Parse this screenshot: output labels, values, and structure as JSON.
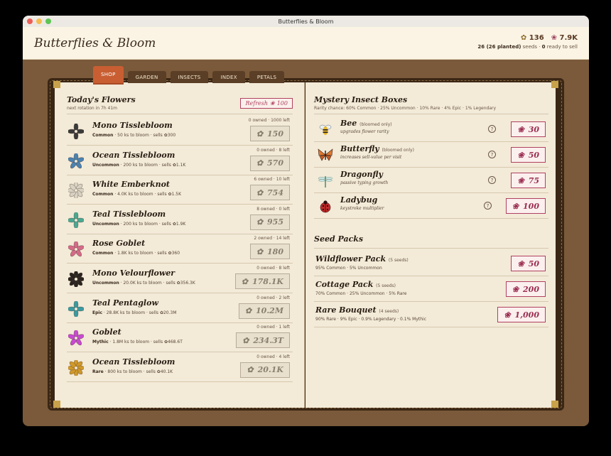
{
  "window": {
    "title": "Butterflies & Bloom"
  },
  "header": {
    "app_title": "Butterflies & Bloom",
    "seeds_count": "136",
    "petals_count": "7.9K",
    "seeds_summary_a": "26 (26 planted)",
    "seeds_summary_b": " seeds · ",
    "ready_count": "0",
    "ready_label": " ready to sell"
  },
  "tabs": [
    {
      "label": "SHOP"
    },
    {
      "label": "GARDEN"
    },
    {
      "label": "INSECTS"
    },
    {
      "label": "INDEX"
    },
    {
      "label": "PETALS"
    }
  ],
  "flowers_section": {
    "title": "Today's Flowers",
    "subtitle": "next rotation in 7h 41m",
    "refresh_label": "Refresh",
    "refresh_cost": "100",
    "items": [
      {
        "name": "Mono Tisslebloom",
        "rarity": "Common",
        "meta": " · 50 ks to bloom · sells ✿300",
        "owned": "0 owned · 1000 left",
        "price": "150",
        "color": "#3a3a3a"
      },
      {
        "name": "Ocean Tisslebloom",
        "rarity": "Uncommon",
        "meta": " · 200 ks to bloom · sells ✿1.1K",
        "owned": "0 owned · 8 left",
        "price": "570",
        "color": "#4a82b0"
      },
      {
        "name": "White Emberknot",
        "rarity": "Common",
        "meta": " · 4.0K ks to bloom · sells ✿1.5K",
        "owned": "6 owned · 10 left",
        "price": "754",
        "color": "#d8d2c4"
      },
      {
        "name": "Teal Tisslebloom",
        "rarity": "Uncommon",
        "meta": " · 200 ks to bloom · sells ✿1.9K",
        "owned": "8 owned · 0 left",
        "price": "955",
        "color": "#4aa892"
      },
      {
        "name": "Rose Goblet",
        "rarity": "Common",
        "meta": " · 1.8K ks to bloom · sells ✿360",
        "owned": "2 owned · 14 left",
        "price": "180",
        "color": "#d46a88"
      },
      {
        "name": "Mono Velourflower",
        "rarity": "Uncommon",
        "meta": " · 20.0K ks to bloom · sells ✿356.3K",
        "owned": "0 owned · 8 left",
        "price": "178.1K",
        "color": "#2a2420"
      },
      {
        "name": "Teal Pentaglow",
        "rarity": "Epic",
        "meta": " · 28.8K ks to bloom · sells ✿20.3M",
        "owned": "0 owned · 2 left",
        "price": "10.2M",
        "color": "#3a9aa0"
      },
      {
        "name": "Goblet",
        "rarity": "Mythic",
        "meta": " · 1.8M ks to bloom · sells ✿468.6T",
        "owned": "0 owned · 1 left",
        "price": "234.3T",
        "color": "#c84ad0"
      },
      {
        "name": "Ocean Tisslebloom",
        "rarity": "Rare",
        "meta": " · 800 ks to bloom · sells ✿40.1K",
        "owned": "0 owned · 4 left",
        "price": "20.1K",
        "color": "#d0982a"
      }
    ]
  },
  "insects_section": {
    "title": "Mystery Insect Boxes",
    "subtitle": "Rarity chance: 60% Common · 25% Uncommon · 10% Rare · 4% Epic · 1% Legendary",
    "items": [
      {
        "name": "Bee",
        "tag": "(bloomed only)",
        "desc": "upgrades flower rarity",
        "price": "30",
        "icon": "bee-icon"
      },
      {
        "name": "Butterfly",
        "tag": "(bloomed only)",
        "desc": "increases sell-value per visit",
        "price": "50",
        "icon": "butterfly-icon"
      },
      {
        "name": "Dragonfly",
        "tag": "",
        "desc": "passive typing growth",
        "price": "75",
        "icon": "dragonfly-icon"
      },
      {
        "name": "Ladybug",
        "tag": "",
        "desc": "keystroke multiplier",
        "price": "100",
        "icon": "ladybug-icon"
      }
    ]
  },
  "seeds_section": {
    "title": "Seed Packs",
    "items": [
      {
        "name": "Wildflower Pack",
        "count": "(5 seeds)",
        "desc": "95% Common · 5% Uncommon",
        "price": "50"
      },
      {
        "name": "Cottage Pack",
        "count": "(5 seeds)",
        "desc": "70% Common · 25% Uncommon · 5% Rare",
        "price": "200"
      },
      {
        "name": "Rare Bouquet",
        "count": "(4 seeds)",
        "desc": "90% Rare · 9% Epic · 0.9% Legendary · 0.1% Mythic",
        "price": "1,000"
      }
    ]
  },
  "colors": {
    "accent": "#c85e32",
    "petal": "#9c2e52",
    "wood": "#7a5a3a",
    "paper": "#f3ead8"
  }
}
